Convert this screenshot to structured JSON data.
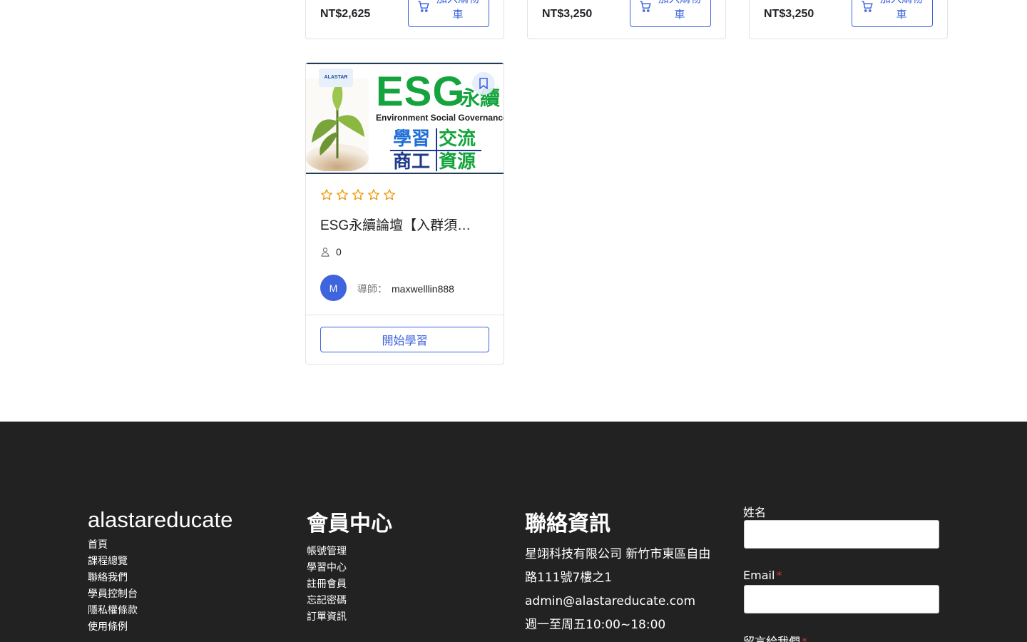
{
  "top_cards": [
    {
      "price": "NT$2,625",
      "cart_label": "加入購物車",
      "cart_icon": "cart-icon"
    },
    {
      "price": "NT$3,250",
      "cart_label": "加入購物車",
      "cart_icon": "cart-icon"
    },
    {
      "price": "NT$3,250",
      "cart_label": "加入購物車",
      "cart_icon": "cart-icon"
    }
  ],
  "course": {
    "thumbnail": {
      "logo_text": "ALASTAR",
      "heading": "ESG",
      "heading_suffix": "永續",
      "subtitle": "Environment Social Governance",
      "cells": [
        "學習",
        "交流",
        "商工",
        "資源"
      ]
    },
    "rating": 0,
    "rating_max": 5,
    "title": "ESG永續論壇【入群須…",
    "enrolled": "0",
    "avatar_initial": "M",
    "instructor_label": "導師：",
    "instructor_name": "maxwelllin888",
    "start_button": "開始學習"
  },
  "footer": {
    "brand": "alastareducate",
    "links": [
      "首頁",
      "課程總覽",
      "聯絡我們",
      "學員控制台",
      "隱私權條款",
      "使用條例"
    ],
    "member_heading": "會員中心",
    "member_links": [
      "帳號管理",
      "學習中心",
      "註冊會員",
      "忘記密碼",
      "訂單資訊"
    ],
    "contact_heading": "聯絡資訊",
    "contact_address": "星翊科技有限公司 新竹市東區自由路111號7樓之1",
    "contact_email": "admin@alastareducate.com",
    "contact_hours": "週一至周五10:00~18:00",
    "form": {
      "name_label": "姓名",
      "email_label": "Email",
      "message_label": "留言給我們",
      "required_mark": "*"
    }
  },
  "colors": {
    "accent": "#3e64de",
    "footer_bg": "#222222",
    "star": "#ed9700",
    "esg_green": "#14a33c",
    "required": "#c2383b"
  }
}
